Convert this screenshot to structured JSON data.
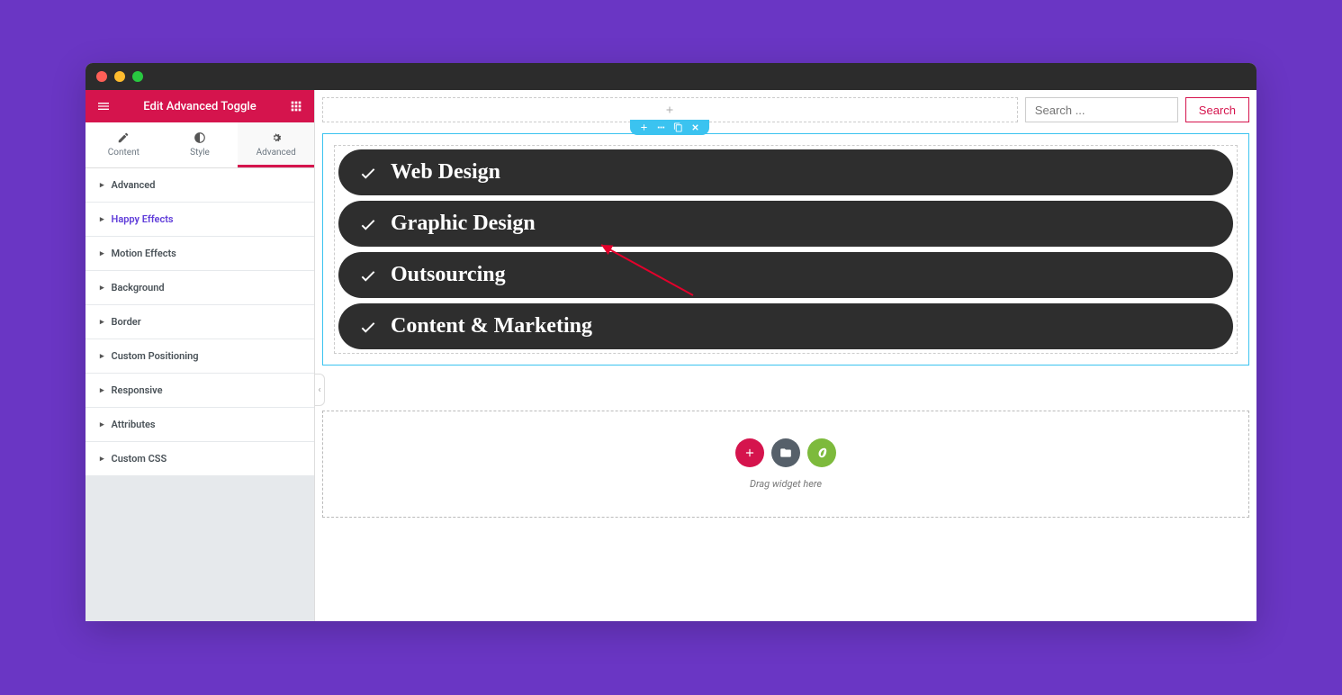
{
  "header": {
    "title": "Edit Advanced Toggle"
  },
  "tabs": {
    "content": "Content",
    "style": "Style",
    "advanced": "Advanced"
  },
  "sections": [
    {
      "label": "Advanced",
      "highlight": false
    },
    {
      "label": "Happy Effects",
      "highlight": true
    },
    {
      "label": "Motion Effects",
      "highlight": false
    },
    {
      "label": "Background",
      "highlight": false
    },
    {
      "label": "Border",
      "highlight": false
    },
    {
      "label": "Custom Positioning",
      "highlight": false
    },
    {
      "label": "Responsive",
      "highlight": false
    },
    {
      "label": "Attributes",
      "highlight": false
    },
    {
      "label": "Custom CSS",
      "highlight": false
    }
  ],
  "search": {
    "placeholder": "Search ...",
    "button": "Search"
  },
  "toggles": [
    {
      "label": "Web Design"
    },
    {
      "label": "Graphic Design"
    },
    {
      "label": "Outsourcing"
    },
    {
      "label": "Content & Marketing"
    }
  ],
  "dropzone": {
    "text": "Drag widget here"
  },
  "colors": {
    "pink": "#d5144d",
    "gray": "#56606a",
    "green": "#7dba3c"
  }
}
